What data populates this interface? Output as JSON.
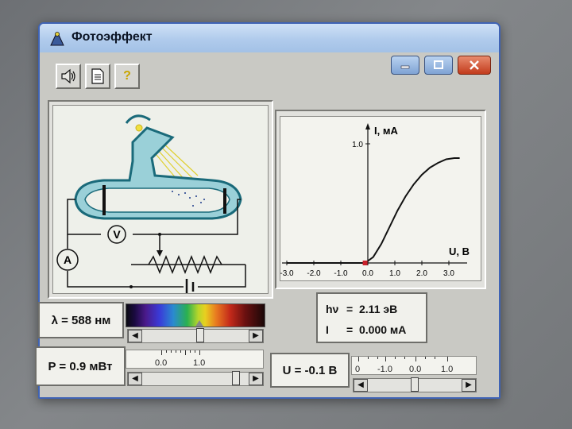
{
  "window": {
    "title": "Фотоэффект",
    "controls": {
      "minimize": "minimize",
      "maximize": "maximize",
      "close": "close"
    }
  },
  "toolbar": {
    "buttons": [
      {
        "name": "sound",
        "icon": "speaker-icon"
      },
      {
        "name": "document",
        "icon": "document-icon"
      },
      {
        "name": "help",
        "icon": "help-icon",
        "label": "?"
      }
    ]
  },
  "circuit": {
    "ammeter_label": "A",
    "voltmeter_label": "V"
  },
  "chart_data": {
    "type": "line",
    "xlabel": "U, B",
    "ylabel": "I, мА",
    "xlim": [
      -3.0,
      3.5
    ],
    "ylim": [
      0,
      1.1
    ],
    "x_ticks": [
      "-3.0",
      "-2.0",
      "-1.0",
      "0.0",
      "1.0",
      "2.0",
      "3.0"
    ],
    "y_ticks": [
      "1.0"
    ],
    "series": [
      {
        "x": [
          -3.0,
          -2.0,
          -1.0,
          -0.1,
          0.2,
          0.5,
          0.8,
          1.1,
          1.4,
          1.7,
          2.0,
          2.3,
          2.6,
          2.9,
          3.2,
          3.4
        ],
        "y": [
          0.0,
          0.0,
          0.0,
          0.0,
          0.05,
          0.16,
          0.3,
          0.44,
          0.56,
          0.66,
          0.74,
          0.8,
          0.84,
          0.87,
          0.88,
          0.88
        ]
      }
    ],
    "marker_point": {
      "x": -0.1,
      "y": 0.0
    },
    "grid": false
  },
  "wavelength": {
    "label": "λ = 588 нм",
    "slider_fraction": 0.55
  },
  "power": {
    "label": "P = 0.9 мВт",
    "scale_labels": [
      "0.0",
      "1.0"
    ],
    "slider_fraction": 0.9
  },
  "voltage": {
    "label": "U = -0.1 В",
    "scale_labels": [
      "0",
      "-1.0",
      "0.0",
      "1.0"
    ],
    "slider_fraction": 0.5
  },
  "readouts": {
    "photon_energy_key": "hν",
    "photon_energy_value": "2.11 эВ",
    "current_key": "I",
    "current_value": "0.000 мА"
  },
  "colors": {
    "tube_fill": "#9ad0d8",
    "tube_outline": "#1a6a7a",
    "curve": "#111111",
    "title_bar": "#b0cbec",
    "close_button": "#c23b1c"
  }
}
